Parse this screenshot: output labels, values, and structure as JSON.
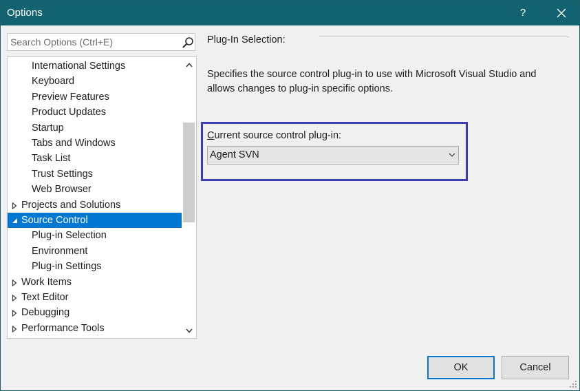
{
  "window": {
    "title": "Options",
    "help_label": "?"
  },
  "search": {
    "placeholder": "Search Options (Ctrl+E)",
    "value": ""
  },
  "tree": {
    "items": [
      {
        "label": "International Settings",
        "level": 2,
        "expander": "none",
        "selected": false
      },
      {
        "label": "Keyboard",
        "level": 2,
        "expander": "none",
        "selected": false
      },
      {
        "label": "Preview Features",
        "level": 2,
        "expander": "none",
        "selected": false
      },
      {
        "label": "Product Updates",
        "level": 2,
        "expander": "none",
        "selected": false
      },
      {
        "label": "Startup",
        "level": 2,
        "expander": "none",
        "selected": false
      },
      {
        "label": "Tabs and Windows",
        "level": 2,
        "expander": "none",
        "selected": false
      },
      {
        "label": "Task List",
        "level": 2,
        "expander": "none",
        "selected": false
      },
      {
        "label": "Trust Settings",
        "level": 2,
        "expander": "none",
        "selected": false
      },
      {
        "label": "Web Browser",
        "level": 2,
        "expander": "none",
        "selected": false
      },
      {
        "label": "Projects and Solutions",
        "level": 1,
        "expander": "collapsed",
        "selected": false
      },
      {
        "label": "Source Control",
        "level": 1,
        "expander": "expanded",
        "selected": true
      },
      {
        "label": "Plug-in Selection",
        "level": 2,
        "expander": "none",
        "selected": false
      },
      {
        "label": "Environment",
        "level": 2,
        "expander": "none",
        "selected": false
      },
      {
        "label": "Plug-in Settings",
        "level": 2,
        "expander": "none",
        "selected": false
      },
      {
        "label": "Work Items",
        "level": 1,
        "expander": "collapsed",
        "selected": false
      },
      {
        "label": "Text Editor",
        "level": 1,
        "expander": "collapsed",
        "selected": false
      },
      {
        "label": "Debugging",
        "level": 1,
        "expander": "collapsed",
        "selected": false
      },
      {
        "label": "Performance Tools",
        "level": 1,
        "expander": "collapsed",
        "selected": false
      }
    ]
  },
  "main": {
    "section_title": "Plug-In Selection:",
    "description": "Specifies the source control plug-in to use with Microsoft Visual Studio and allows changes to plug-in specific options.",
    "plugin_label_accel": "C",
    "plugin_label_rest": "urrent source control plug-in:",
    "plugin_value": "Agent SVN"
  },
  "buttons": {
    "ok": "OK",
    "cancel": "Cancel"
  },
  "colors": {
    "titlebar": "#12636f",
    "selection": "#0078d4",
    "highlight_border": "#3c3cb4"
  }
}
